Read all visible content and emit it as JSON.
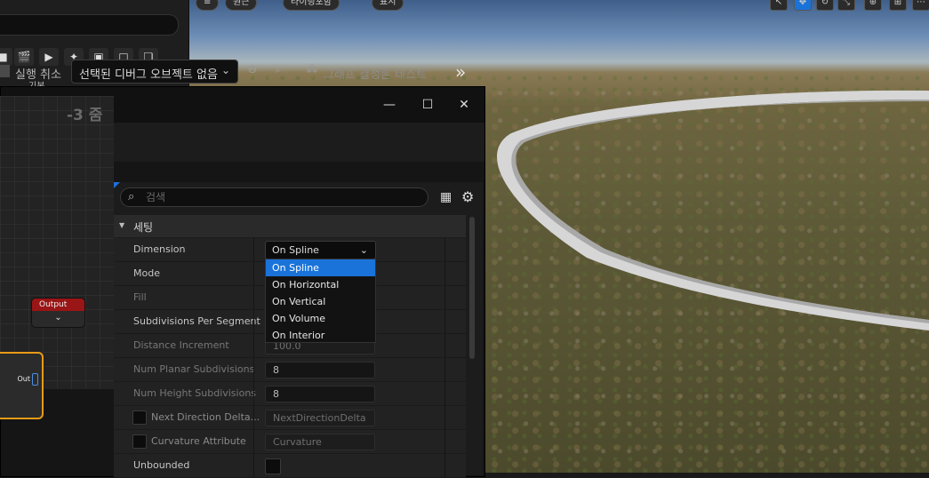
{
  "viewport": {
    "top_buttons": [
      "",
      "원근",
      "라이팅포함",
      "표시"
    ],
    "tool_icons": [
      "select-icon",
      "move-icon",
      "rotate-icon",
      "scale-icon",
      "camera-icon",
      "more-icon"
    ]
  },
  "top_panel": {
    "basic_label": "기본",
    "icons": [
      "cube-icon",
      "film-icon",
      "play-icon",
      "sparkle-icon",
      "blocks-icon",
      "square-icon",
      "layers-icon"
    ]
  },
  "window": {
    "close_glyph": "✕",
    "max_glyph": "☐",
    "min_glyph": "—"
  },
  "toolbar": {
    "undo_label": "실행 취소",
    "debug_object": "선택된 디버그 오브젝트 없음",
    "graph_test_label": "그래프 결정론 테스트"
  },
  "graph": {
    "zoom_label": "-3 줌",
    "output_node_title": "Output",
    "selected_node_pin": "Out"
  },
  "details": {
    "search_placeholder": "검색",
    "section_title": "세팅",
    "rows": [
      {
        "name": "Dimension",
        "value": "On Spline"
      },
      {
        "name": "Mode",
        "value": ""
      },
      {
        "name": "Fill",
        "value": ""
      },
      {
        "name": "Subdivisions Per Segment",
        "value": ""
      },
      {
        "name": "Distance Increment",
        "value": "100.0"
      },
      {
        "name": "Num Planar Subdivisions",
        "value": "8"
      },
      {
        "name": "Num Height Subdivisions",
        "value": "8"
      },
      {
        "name": "Next Direction Delta...",
        "value": "NextDirectionDelta"
      },
      {
        "name": "Curvature Attribute",
        "value": "Curvature"
      },
      {
        "name": "Unbounded",
        "value": ""
      }
    ],
    "dropdown_options": [
      "On Spline",
      "On Horizontal",
      "On Vertical",
      "On Volume",
      "On Interior"
    ],
    "selected_option": "On Spline"
  }
}
